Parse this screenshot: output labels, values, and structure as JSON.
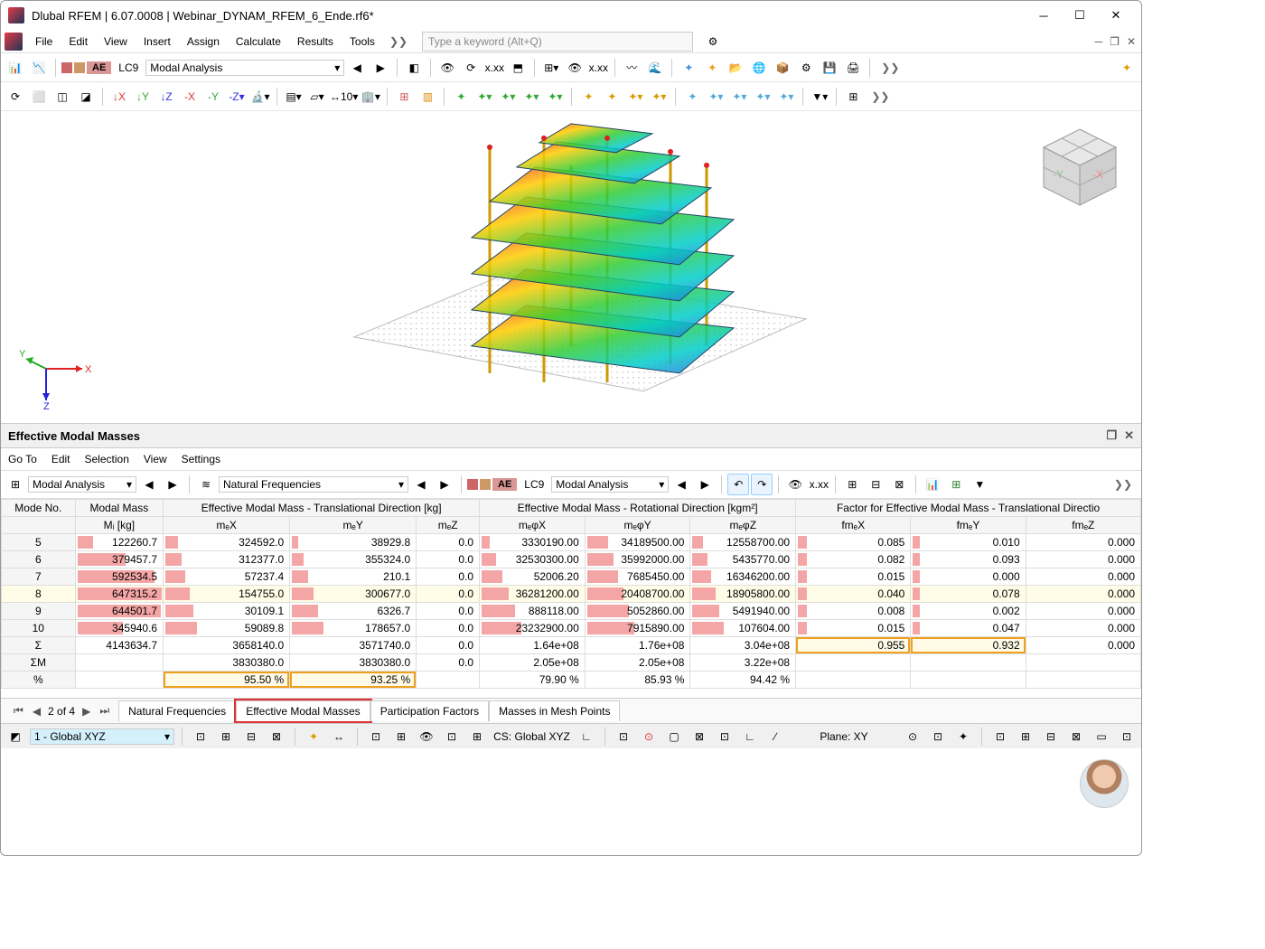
{
  "window": {
    "title": "Dlubal RFEM | 6.07.0008 | Webinar_DYNAM_RFEM_6_Ende.rf6*"
  },
  "menu": {
    "items": [
      "File",
      "Edit",
      "View",
      "Insert",
      "Assign",
      "Calculate",
      "Results",
      "Tools"
    ],
    "search_placeholder": "Type a keyword (Alt+Q)"
  },
  "toolbar1": {
    "ae": "AE",
    "lc": "LC9",
    "analysis": "Modal Analysis"
  },
  "panel": {
    "title": "Effective Modal Masses",
    "menu": [
      "Go To",
      "Edit",
      "Selection",
      "View",
      "Settings"
    ],
    "combo1": "Modal Analysis",
    "combo2": "Natural Frequencies",
    "ae": "AE",
    "lc": "LC9",
    "analysis": "Modal Analysis"
  },
  "table": {
    "group_headers": [
      "Mode No.",
      "Modal Mass",
      "Effective Modal Mass - Translational Direction [kg]",
      "Effective Modal Mass - Rotational Direction [kgm²]",
      "Factor for Effective Modal Mass - Translational Directio"
    ],
    "sub_headers": [
      "",
      "Mᵢ [kg]",
      "mₑX",
      "mₑY",
      "mₑZ",
      "mₑφX",
      "mₑφY",
      "mₑφZ",
      "fmₑX",
      "fmₑY",
      "fmₑZ"
    ],
    "rows": [
      {
        "n": "5",
        "mi": "122260.7",
        "mx": "324592.0",
        "my": "38929.8",
        "mz": "0.0",
        "rx": "3330190.00",
        "ry": "34189500.00",
        "rz": "12558700.00",
        "fx": "0.085",
        "fy": "0.010",
        "fz": "0.000"
      },
      {
        "n": "6",
        "mi": "379457.7",
        "mx": "312377.0",
        "my": "355324.0",
        "mz": "0.0",
        "rx": "32530300.00",
        "ry": "35992000.00",
        "rz": "5435770.00",
        "fx": "0.082",
        "fy": "0.093",
        "fz": "0.000"
      },
      {
        "n": "7",
        "mi": "592534.5",
        "mx": "57237.4",
        "my": "210.1",
        "mz": "0.0",
        "rx": "52006.20",
        "ry": "7685450.00",
        "rz": "16346200.00",
        "fx": "0.015",
        "fy": "0.000",
        "fz": "0.000"
      },
      {
        "n": "8",
        "mi": "647315.2",
        "mx": "154755.0",
        "my": "300677.0",
        "mz": "0.0",
        "rx": "36281200.00",
        "ry": "20408700.00",
        "rz": "18905800.00",
        "fx": "0.040",
        "fy": "0.078",
        "fz": "0.000"
      },
      {
        "n": "9",
        "mi": "644501.7",
        "mx": "30109.1",
        "my": "6326.7",
        "mz": "0.0",
        "rx": "888118.00",
        "ry": "5052860.00",
        "rz": "5491940.00",
        "fx": "0.008",
        "fy": "0.002",
        "fz": "0.000"
      },
      {
        "n": "10",
        "mi": "345940.6",
        "mx": "59089.8",
        "my": "178657.0",
        "mz": "0.0",
        "rx": "23232900.00",
        "ry": "7915890.00",
        "rz": "107604.00",
        "fx": "0.015",
        "fy": "0.047",
        "fz": "0.000"
      }
    ],
    "sum": {
      "n": "Σ",
      "mi": "4143634.7",
      "mx": "3658140.0",
      "my": "3571740.0",
      "mz": "0.0",
      "rx": "1.64e+08",
      "ry": "1.76e+08",
      "rz": "3.04e+08",
      "fx": "0.955",
      "fy": "0.932",
      "fz": "0.000"
    },
    "sm": {
      "n": "ΣM",
      "mi": "",
      "mx": "3830380.0",
      "my": "3830380.0",
      "mz": "0.0",
      "rx": "2.05e+08",
      "ry": "2.05e+08",
      "rz": "3.22e+08",
      "fx": "",
      "fy": "",
      "fz": ""
    },
    "pct": {
      "n": "%",
      "mi": "",
      "mx": "95.50 %",
      "my": "93.25 %",
      "mz": "",
      "rx": "79.90 %",
      "ry": "85.93 %",
      "rz": "94.42 %",
      "fx": "",
      "fy": "",
      "fz": ""
    }
  },
  "tabs": {
    "page": "2 of 4",
    "items": [
      "Natural Frequencies",
      "Effective Modal Masses",
      "Participation Factors",
      "Masses in Mesh Points"
    ]
  },
  "status": {
    "coord": "1 - Global XYZ",
    "cs": "CS: Global XYZ",
    "plane": "Plane: XY"
  },
  "axes": {
    "x": "X",
    "y": "Y",
    "z": "Z"
  },
  "cube": {
    "x": "-X",
    "y": "-Y"
  }
}
